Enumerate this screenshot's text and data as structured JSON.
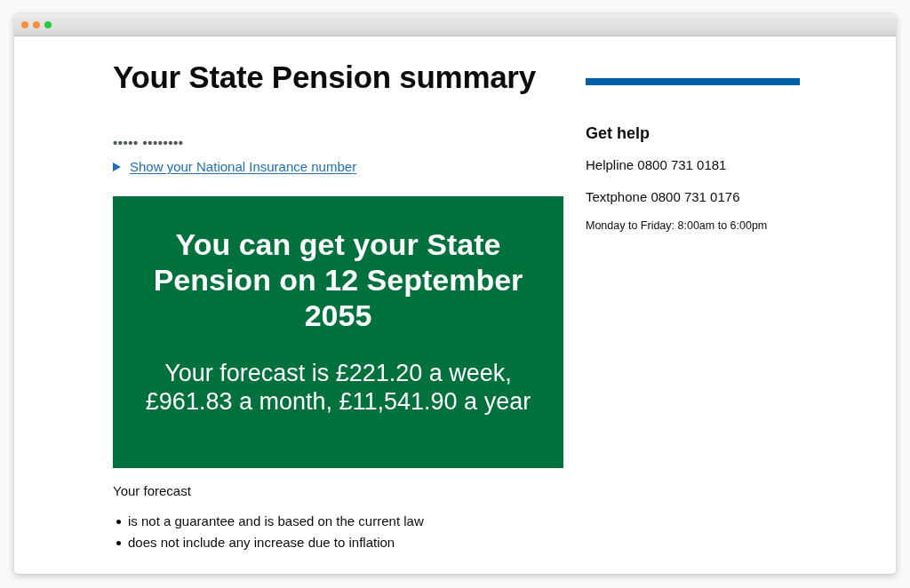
{
  "page": {
    "title": "Your State Pension summary"
  },
  "national_insurance": {
    "masked_number": "••••• ••••••••",
    "toggle": {
      "label": "Show your National Insurance number",
      "expanded": false
    }
  },
  "panel": {
    "title": "You can get your State Pension on 12 September 2055",
    "body": "Your forecast is £221.20 a week, £961.83 a month, £11,541.90 a year"
  },
  "forecast": {
    "intro": "Your forecast",
    "points": [
      "is not a guarantee and is based on the current law",
      "does not include any increase due to inflation"
    ]
  },
  "help": {
    "title": "Get help",
    "lines": [
      "Helpline 0800 731 0181",
      "Textphone 0800 731 0176"
    ],
    "hours": "Monday to Friday: 8:00am to 6:00pm"
  }
}
